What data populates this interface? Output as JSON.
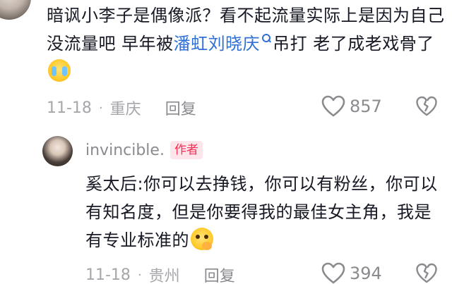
{
  "comments": [
    {
      "text_before": "暗讽小李子是偶像派？看不起流量实际上是因为自己没流量吧 早年被",
      "mention": "潘虹刘晓庆",
      "text_after": "吊打 老了成老戏骨了",
      "emoji": "loudly-crying-face",
      "date": "11-18",
      "location": "重庆",
      "reply_label": "回复",
      "likes": "857"
    }
  ],
  "reply": {
    "username": "invincible.",
    "badge": "作者",
    "text": "奚太后:你可以去挣钱，你可以有粉丝，你可以有知名度，但是你要得我的最佳女主角，我是有专业标准的",
    "emoji": "face-with-hand-over-mouth",
    "date": "11-18",
    "location": "贵州",
    "reply_label": "回复",
    "likes": "394"
  },
  "icons": {
    "like": "heart-outline-icon",
    "dislike": "broken-heart-icon",
    "mention": "search-icon"
  },
  "colors": {
    "text": "#161823",
    "meta": "#a7a7ab",
    "mention": "#2f6fd6",
    "author_badge_text": "#fe2c55",
    "author_badge_bg": "#fde5ea"
  }
}
